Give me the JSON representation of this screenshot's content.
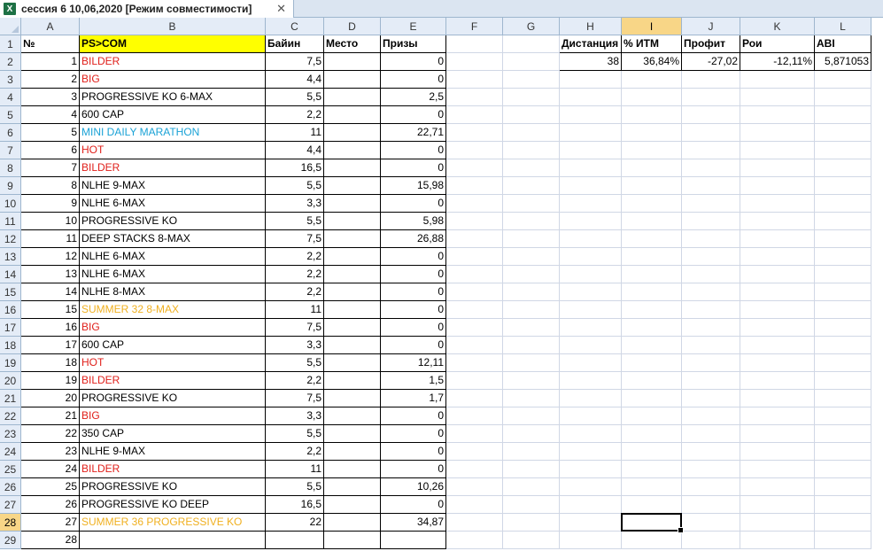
{
  "window": {
    "tab_title": "сессия 6 10,06,2020  [Режим совместимости]",
    "excel_icon": "excel-icon",
    "close_symbol": "✕"
  },
  "colors": {
    "red": "#e0201b",
    "blue": "#1aa2d6",
    "orange": "#f0b020",
    "black": "#000000",
    "yellow_fill": "#ffff00",
    "selection_header": "#f8d687"
  },
  "columns": [
    "A",
    "B",
    "C",
    "D",
    "E",
    "F",
    "G",
    "H",
    "I",
    "J",
    "K",
    "L"
  ],
  "rows": [
    "1",
    "2",
    "3",
    "4",
    "5",
    "6",
    "7",
    "8",
    "9",
    "10",
    "11",
    "12",
    "13",
    "14",
    "15",
    "16",
    "17",
    "18",
    "19",
    "20",
    "21",
    "22",
    "23",
    "24",
    "25",
    "26",
    "27",
    "28",
    "29"
  ],
  "headers": {
    "A": "№",
    "B": "PS>COM",
    "C": "Байин",
    "D": "Место",
    "E": "Призы"
  },
  "stats": {
    "headers": [
      "Дистанция",
      "% ИТМ",
      "Профит",
      "Рои",
      "ABI"
    ],
    "values": [
      "38",
      "36,84%",
      "-27,02",
      "-12,11%",
      "5,871053"
    ]
  },
  "records": [
    {
      "n": "1",
      "name": "BILDER",
      "color": "red",
      "buyin": "7,5",
      "place": "",
      "prize": "0"
    },
    {
      "n": "2",
      "name": "BIG",
      "color": "red",
      "buyin": "4,4",
      "place": "",
      "prize": "0"
    },
    {
      "n": "3",
      "name": "PROGRESSIVE KO 6-MAX",
      "color": "black",
      "buyin": "5,5",
      "place": "",
      "prize": "2,5"
    },
    {
      "n": "4",
      "name": "600 CAP",
      "color": "black",
      "buyin": "2,2",
      "place": "",
      "prize": "0"
    },
    {
      "n": "5",
      "name": "MINI DAILY MARATHON",
      "color": "blue",
      "buyin": "11",
      "place": "",
      "prize": "22,71"
    },
    {
      "n": "6",
      "name": "HOT",
      "color": "red",
      "buyin": "4,4",
      "place": "",
      "prize": "0"
    },
    {
      "n": "7",
      "name": "BILDER",
      "color": "red",
      "buyin": "16,5",
      "place": "",
      "prize": "0"
    },
    {
      "n": "8",
      "name": "NLHE 9-MAX",
      "color": "black",
      "buyin": "5,5",
      "place": "",
      "prize": "15,98"
    },
    {
      "n": "9",
      "name": "NLHE 6-MAX",
      "color": "black",
      "buyin": "3,3",
      "place": "",
      "prize": "0"
    },
    {
      "n": "10",
      "name": "PROGRESSIVE KO",
      "color": "black",
      "buyin": "5,5",
      "place": "",
      "prize": "5,98"
    },
    {
      "n": "11",
      "name": "DEEP STACKS 8-MAX",
      "color": "black",
      "buyin": "7,5",
      "place": "",
      "prize": "26,88"
    },
    {
      "n": "12",
      "name": "NLHE 6-MAX",
      "color": "black",
      "buyin": "2,2",
      "place": "",
      "prize": "0"
    },
    {
      "n": "13",
      "name": "NLHE 6-MAX",
      "color": "black",
      "buyin": "2,2",
      "place": "",
      "prize": "0"
    },
    {
      "n": "14",
      "name": "NLHE 8-MAX",
      "color": "black",
      "buyin": "2,2",
      "place": "",
      "prize": "0"
    },
    {
      "n": "15",
      "name": "SUMMER 32 8-MAX",
      "color": "orange",
      "buyin": "11",
      "place": "",
      "prize": "0"
    },
    {
      "n": "16",
      "name": "BIG",
      "color": "red",
      "buyin": "7,5",
      "place": "",
      "prize": "0"
    },
    {
      "n": "17",
      "name": "600 CAP",
      "color": "black",
      "buyin": "3,3",
      "place": "",
      "prize": "0"
    },
    {
      "n": "18",
      "name": "HOT",
      "color": "red",
      "buyin": "5,5",
      "place": "",
      "prize": "12,11"
    },
    {
      "n": "19",
      "name": "BILDER",
      "color": "red",
      "buyin": "2,2",
      "place": "",
      "prize": "1,5"
    },
    {
      "n": "20",
      "name": "PROGRESSIVE KO",
      "color": "black",
      "buyin": "7,5",
      "place": "",
      "prize": "1,7"
    },
    {
      "n": "21",
      "name": "BIG",
      "color": "red",
      "buyin": "3,3",
      "place": "",
      "prize": "0"
    },
    {
      "n": "22",
      "name": "350 CAP",
      "color": "black",
      "buyin": "5,5",
      "place": "",
      "prize": "0"
    },
    {
      "n": "23",
      "name": "NLHE 9-MAX",
      "color": "black",
      "buyin": "2,2",
      "place": "",
      "prize": "0"
    },
    {
      "n": "24",
      "name": "BILDER",
      "color": "red",
      "buyin": "11",
      "place": "",
      "prize": "0"
    },
    {
      "n": "25",
      "name": "PROGRESSIVE KO",
      "color": "black",
      "buyin": "5,5",
      "place": "",
      "prize": "10,26"
    },
    {
      "n": "26",
      "name": "PROGRESSIVE KO  DEEP",
      "color": "black",
      "buyin": "16,5",
      "place": "",
      "prize": "0"
    },
    {
      "n": "27",
      "name": "SUMMER 36  PROGRESSIVE KO",
      "color": "orange",
      "buyin": "22",
      "place": "",
      "prize": "34,87"
    },
    {
      "n": "28",
      "name": "",
      "color": "black",
      "buyin": "",
      "place": "",
      "prize": ""
    }
  ],
  "selection": {
    "column": "I",
    "row": "28"
  }
}
